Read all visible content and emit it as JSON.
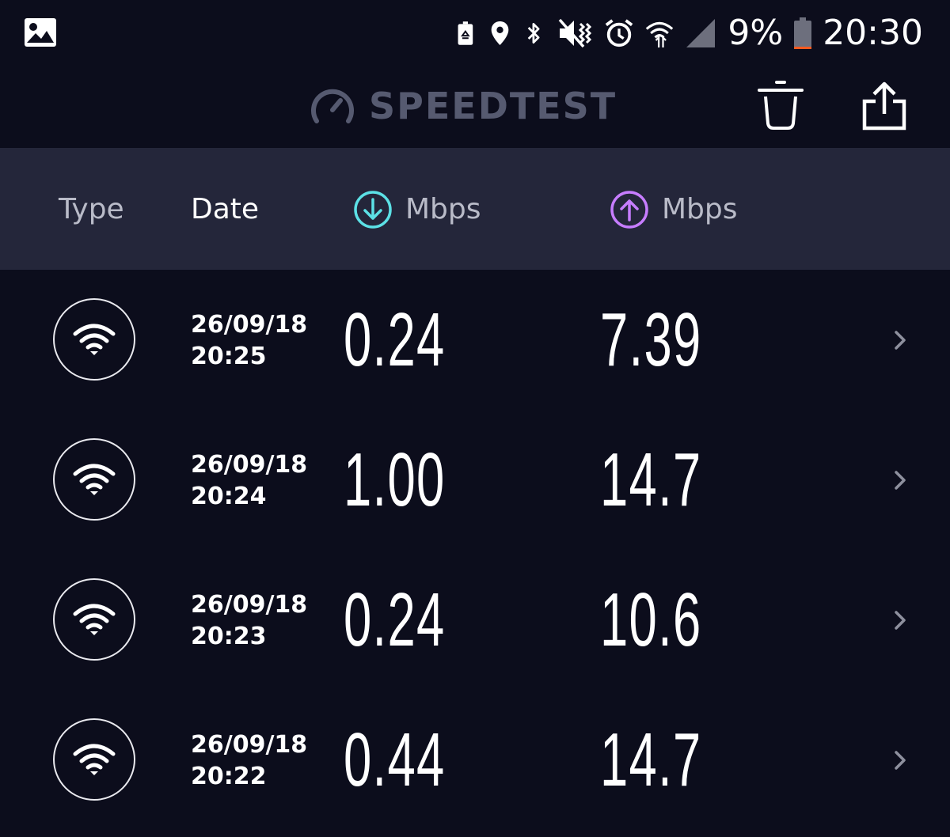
{
  "status_bar": {
    "battery_percent": "9%",
    "time": "20:30",
    "battery_level": 0.09,
    "battery_low_color": "#ff5a1f",
    "icons": [
      "image-icon",
      "battery-saver-icon",
      "location-icon",
      "bluetooth-icon",
      "vibrate-mute-icon",
      "alarm-icon",
      "wifi-signal-icon",
      "cell-signal-icon",
      "battery-icon"
    ]
  },
  "app_bar": {
    "title": "SPEEDTEST",
    "logo_icon": "speedometer-icon",
    "actions": [
      "trash-icon",
      "share-icon"
    ]
  },
  "table_header": {
    "type": "Type",
    "date": "Date",
    "download_unit": "Mbps",
    "upload_unit": "Mbps",
    "download_icon": "download-arrow-icon",
    "upload_icon": "upload-arrow-icon",
    "download_color": "#5ce1e6",
    "upload_color": "#c77dff"
  },
  "results": [
    {
      "type_icon": "wifi-icon",
      "date": "26/09/18",
      "time": "20:25",
      "download": "0.24",
      "upload": "7.39"
    },
    {
      "type_icon": "wifi-icon",
      "date": "26/09/18",
      "time": "20:24",
      "download": "1.00",
      "upload": "14.7"
    },
    {
      "type_icon": "wifi-icon",
      "date": "26/09/18",
      "time": "20:23",
      "download": "0.24",
      "upload": "10.6"
    },
    {
      "type_icon": "wifi-icon",
      "date": "26/09/18",
      "time": "20:22",
      "download": "0.44",
      "upload": "14.7"
    }
  ]
}
